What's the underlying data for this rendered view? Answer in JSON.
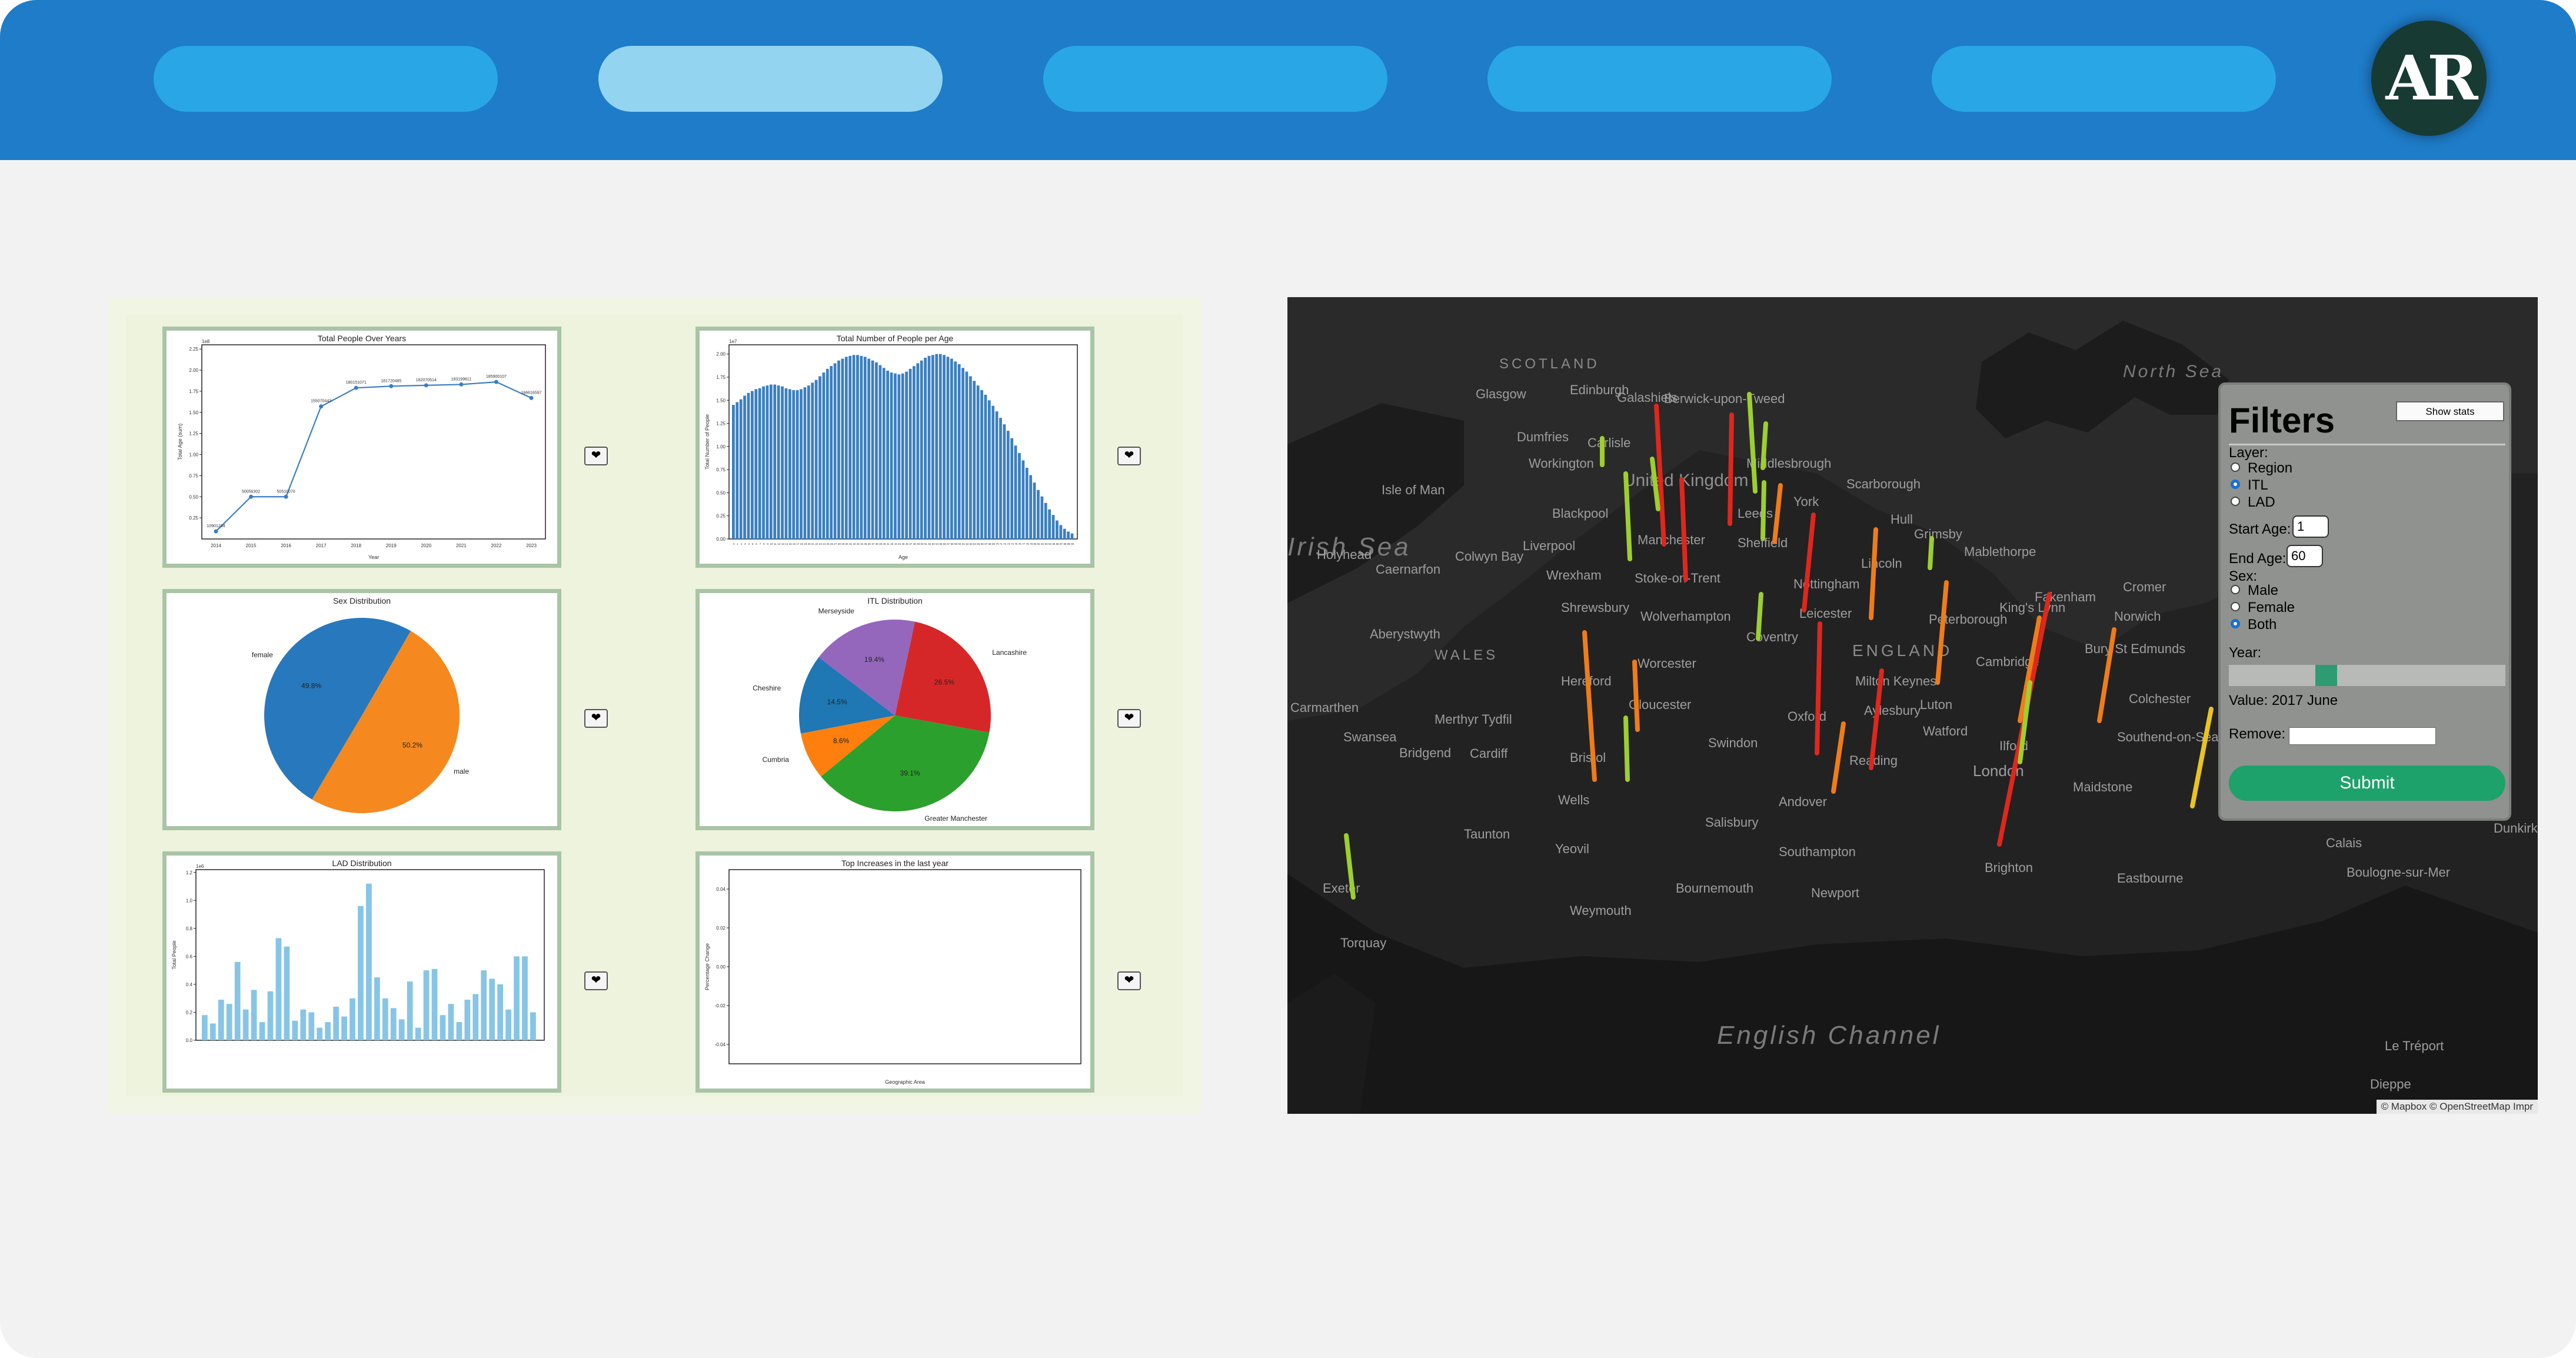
{
  "nav": {
    "pills": [
      {
        "label": "",
        "active": false
      },
      {
        "label": "",
        "active": true
      },
      {
        "label": "",
        "active": false
      },
      {
        "label": "",
        "active": false
      },
      {
        "label": "",
        "active": false
      }
    ],
    "logo_text": "AR"
  },
  "dashboard": {
    "favorite_icon": "heart-icon",
    "favorite_glyph": "❤",
    "cards": [
      {
        "title": "Total People Over Years"
      },
      {
        "title": "Total Number of People per Age"
      },
      {
        "title": "Sex Distribution"
      },
      {
        "title": "ITL Distribution"
      },
      {
        "title": "LAD Distribution"
      },
      {
        "title": "Top Increases in the last year"
      }
    ]
  },
  "chart_data": [
    {
      "type": "line",
      "title": "Total People Over Years",
      "xlabel": "Year",
      "ylabel": "Total Age (sum)",
      "scale_label": "1e8",
      "x": [
        2014,
        2015,
        2016,
        2017,
        2018,
        2019,
        2020,
        2021,
        2022,
        2023
      ],
      "y": [
        0.09,
        0.5,
        0.5,
        1.57,
        1.79,
        1.81,
        1.82,
        1.83,
        1.86,
        1.67
      ],
      "data_labels": [
        "10901234",
        "50056302",
        "50510070",
        "155070443",
        "180151071",
        "181720485",
        "182070514",
        "183199611",
        "185900107",
        "166616597"
      ],
      "yticks": [
        "0.25",
        "0.50",
        "0.75",
        "1.00",
        "1.25",
        "1.50",
        "1.75",
        "2.00",
        "2.25"
      ],
      "ylim": [
        0,
        2.3
      ],
      "color": "#3b7fc1"
    },
    {
      "type": "bar",
      "title": "Total Number of People per Age",
      "xlabel": "Age",
      "ylabel": "Total Number of People",
      "scale_label": "1e7",
      "ages_start": 0,
      "values": [
        1.45,
        1.48,
        1.51,
        1.55,
        1.58,
        1.6,
        1.62,
        1.63,
        1.65,
        1.66,
        1.67,
        1.67,
        1.66,
        1.65,
        1.63,
        1.62,
        1.61,
        1.61,
        1.62,
        1.64,
        1.66,
        1.69,
        1.72,
        1.76,
        1.8,
        1.84,
        1.87,
        1.9,
        1.93,
        1.95,
        1.97,
        1.98,
        1.99,
        1.99,
        1.98,
        1.97,
        1.95,
        1.93,
        1.91,
        1.88,
        1.85,
        1.82,
        1.8,
        1.79,
        1.78,
        1.79,
        1.81,
        1.84,
        1.87,
        1.9,
        1.93,
        1.96,
        1.98,
        1.99,
        2.0,
        2.0,
        1.99,
        1.97,
        1.95,
        1.92,
        1.89,
        1.85,
        1.81,
        1.76,
        1.71,
        1.66,
        1.61,
        1.56,
        1.5,
        1.44,
        1.38,
        1.31,
        1.24,
        1.17,
        1.09,
        1.01,
        0.93,
        0.85,
        0.77,
        0.69,
        0.61,
        0.53,
        0.46,
        0.39,
        0.32,
        0.26,
        0.2,
        0.15,
        0.11,
        0.08,
        0.06
      ],
      "yticks": [
        "0.00",
        "0.25",
        "0.50",
        "0.75",
        "1.00",
        "1.25",
        "1.50",
        "1.75",
        "2.00"
      ],
      "ylim": [
        0,
        2.1
      ],
      "color": "#3b7fc1"
    },
    {
      "type": "pie",
      "title": "Sex Distribution",
      "slices": [
        {
          "label": "male",
          "pct": "50.2%",
          "value": 50.2,
          "color": "#f5891f"
        },
        {
          "label": "female",
          "pct": "49.8%",
          "value": 49.8,
          "color": "#2878bd"
        }
      ]
    },
    {
      "type": "pie",
      "title": "ITL Distribution",
      "slices": [
        {
          "label": "Lancashire",
          "pct": "26.5%",
          "value": 26.5,
          "color": "#d62728"
        },
        {
          "label": "Greater Manchester",
          "pct": "39.1%",
          "value": 39.1,
          "color": "#2ca02c"
        },
        {
          "label": "Cumbria",
          "pct": "8.6%",
          "value": 8.6,
          "color": "#ff7f0e"
        },
        {
          "label": "Cheshire",
          "pct": "14.5%",
          "value": 14.5,
          "color": "#1f77b4"
        },
        {
          "label": "Merseyside",
          "pct": "19.4%",
          "value": 19.4,
          "color": "#9467bd"
        }
      ]
    },
    {
      "type": "bar",
      "title": "LAD Distribution",
      "xlabel": "Location",
      "ylabel": "Total People",
      "scale_label": "1e6",
      "values": [
        0.18,
        0.12,
        0.29,
        0.26,
        0.56,
        0.22,
        0.36,
        0.13,
        0.35,
        0.73,
        0.67,
        0.14,
        0.22,
        0.2,
        0.09,
        0.13,
        0.24,
        0.17,
        0.3,
        0.96,
        1.12,
        0.45,
        0.3,
        0.23,
        0.15,
        0.42,
        0.09,
        0.5,
        0.51,
        0.18,
        0.26,
        0.13,
        0.29,
        0.33,
        0.5,
        0.44,
        0.4,
        0.22,
        0.6,
        0.6,
        0.2
      ],
      "yticks": [
        "0.0",
        "0.2",
        "0.4",
        "0.6",
        "0.8",
        "1.0",
        "1.2"
      ],
      "ylim": [
        0,
        1.22
      ],
      "color": "#87c5e6"
    },
    {
      "type": "bar",
      "title": "Top Increases in the last year",
      "xlabel": "Geographic Area",
      "ylabel": "Percentage Change",
      "values": [],
      "yticks": [
        "0.04",
        "0.02",
        "0.00",
        "-0.02",
        "-0.04"
      ],
      "ylim": [
        -0.05,
        0.05
      ]
    }
  ],
  "map": {
    "labels": {
      "scotland": "SCOTLAND",
      "united_kingdom": "United Kingdom",
      "isle_of_man": "Isle of Man",
      "irish_sea": "Irish Sea",
      "wales": "WALES",
      "england": "ENGLAND",
      "north_sea": "North Sea",
      "english_channel": "English Channel",
      "edinburgh": "Edinburgh",
      "glasgow": "Glasgow",
      "carlisle": "Carlisle",
      "middlesbrough": "Middlesbrough",
      "scarborough": "Scarborough",
      "york": "York",
      "leeds": "Leeds",
      "hull": "Hull",
      "blackpool": "Blackpool",
      "liverpool": "Liverpool",
      "manchester": "Manchester",
      "sheffield": "Sheffield",
      "grimsby": "Grimsby",
      "lincoln": "Lincoln",
      "nottingham": "Nottingham",
      "stoke": "Stoke-on-Trent",
      "wrexham": "Wrexham",
      "shrewsbury": "Shrewsbury",
      "wolverhampton": "Wolverhampton",
      "coventry": "Coventry",
      "leicester": "Leicester",
      "peterborough": "Peterborough",
      "norwich": "Norwich",
      "aberystwyth": "Aberystwyth",
      "hereford": "Hereford",
      "worcester": "Worcester",
      "milton_keynes": "Milton Keynes",
      "cambridge": "Cambridge",
      "luton": "Luton",
      "gloucester": "Gloucester",
      "oxford": "Oxford",
      "aylesbury": "Aylesbury",
      "watford": "Watford",
      "ilford": "Ilford",
      "colchester": "Colchester",
      "swansea": "Swansea",
      "cardiff": "Cardiff",
      "bristol": "Bristol",
      "swindon": "Swindon",
      "reading": "Reading",
      "london": "London",
      "maidstone": "Maidstone",
      "southend": "Southend-on-Sea",
      "exeter": "Exeter",
      "taunton": "Taunton",
      "yeovil": "Yeovil",
      "salisbury": "Salisbury",
      "southampton": "Southampton",
      "bournemouth": "Bournemouth",
      "brighton": "Brighton",
      "eastbourne": "Eastbourne",
      "weymouth": "Weymouth",
      "newport": "Newport",
      "torquay": "Torquay",
      "calais": "Calais",
      "boulogne": "Boulogne-sur-Mer",
      "dunkirk": "Dunkirk",
      "le_treport": "Le Tréport",
      "dieppe": "Dieppe",
      "andover": "Andover",
      "wells": "Wells",
      "bridgend": "Bridgend",
      "carmarthen": "Carmarthen",
      "merthyr": "Merthyr Tydfil",
      "caernarfon": "Caernarfon",
      "holyhead": "Holyhead",
      "colwyn_bay": "Colwyn Bay",
      "fakenham": "Fakenham",
      "cromer": "Cromer",
      "kings_lynn": "King's Lynn",
      "bury": "Bury St Edmunds",
      "mablethorpe": "Mablethorpe",
      "berwick": "Berwick-upon-Tweed",
      "dumfries": "Dumfries",
      "workington": "Workington",
      "galashiels": "Galashiels"
    },
    "attribution": "© Mapbox © OpenStreetMap Impr",
    "bar_colors": [
      "#e0261d",
      "#f07c18",
      "#9dcf2e",
      "#e9c31f"
    ]
  },
  "filters": {
    "title": "Filters",
    "show_stats_label": "Show stats",
    "layer_label": "Layer:",
    "layer_options": [
      {
        "label": "Region",
        "checked": false
      },
      {
        "label": "ITL",
        "checked": true
      },
      {
        "label": "LAD",
        "checked": false
      }
    ],
    "start_age_label": "Start Age:",
    "start_age_value": "1",
    "end_age_label": "End Age:",
    "end_age_value": "60",
    "sex_label": "Sex:",
    "sex_options": [
      {
        "label": "Male",
        "checked": false
      },
      {
        "label": "Female",
        "checked": false
      },
      {
        "label": "Both",
        "checked": true
      }
    ],
    "year_label": "Year:",
    "year_slider_fraction": 0.34,
    "value_text": "Value: 2017 June",
    "remove_label": "Remove:",
    "remove_value": "",
    "submit_label": "Submit"
  }
}
